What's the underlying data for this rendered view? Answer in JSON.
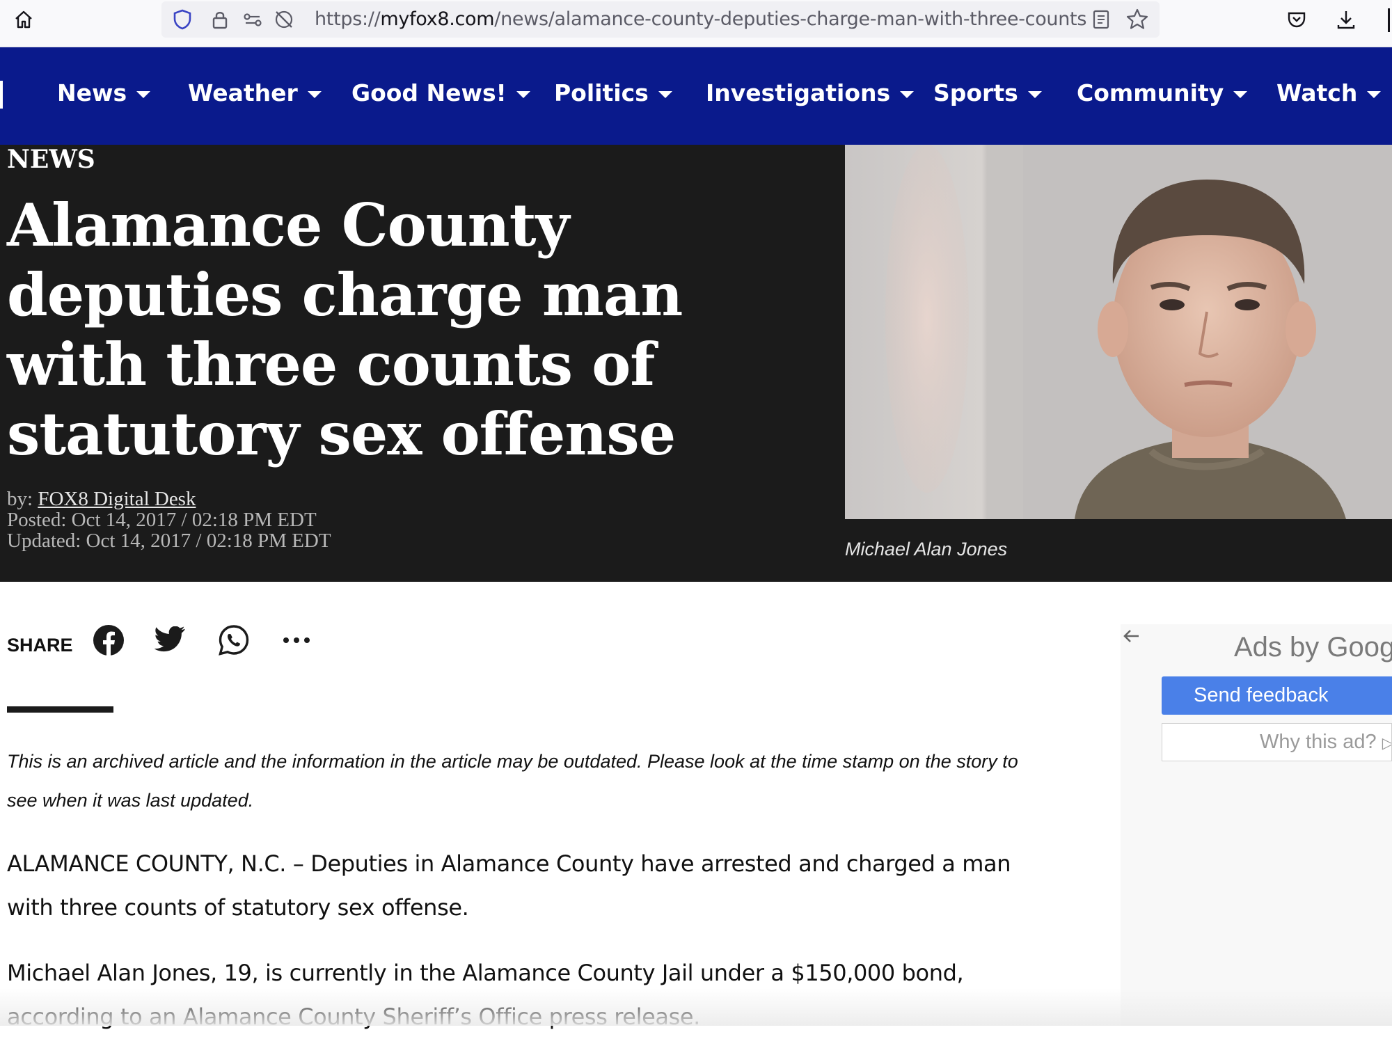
{
  "browser": {
    "url_scheme": "https://",
    "url_domain": "myfox8.com",
    "url_path": "/news/alamance-county-deputies-charge-man-with-three-counts"
  },
  "nav": {
    "items": [
      {
        "label": "News"
      },
      {
        "label": "Weather"
      },
      {
        "label": "Good News!"
      },
      {
        "label": "Politics"
      },
      {
        "label": "Investigations"
      },
      {
        "label": "Sports"
      },
      {
        "label": "Community"
      },
      {
        "label": "Watch"
      }
    ]
  },
  "article": {
    "kicker": "NEWS",
    "headline": "Alamance County deputies charge man with three counts of statutory sex offense",
    "byline_prefix": "by:",
    "author": "FOX8 Digital Desk",
    "posted": "Posted: Oct 14, 2017 / 02:18 PM EDT",
    "updated": "Updated: Oct 14, 2017 / 02:18 PM EDT",
    "photo_caption": "Michael Alan Jones",
    "share_label": "SHARE",
    "archived_notice": "This is an archived article and the information in the article may be outdated. Please look at the time stamp on the story to see when it was last updated.",
    "paragraphs": [
      "ALAMANCE COUNTY, N.C. – Deputies in Alamance County have arrested and charged a man with three counts of statutory sex offense.",
      "Michael Alan Jones, 19, is currently in the Alamance County Jail under a $150,000 bond, according to an Alamance County Sheriff’s Office press release."
    ]
  },
  "ads": {
    "ads_by": "Ads by Goog",
    "send_feedback": "Send feedback",
    "why_this_ad": "Why this ad?"
  },
  "colors": {
    "nav_bg": "#0a1a8c",
    "hero_bg": "#1b1b1b",
    "feedback_button": "#4a80e8"
  }
}
